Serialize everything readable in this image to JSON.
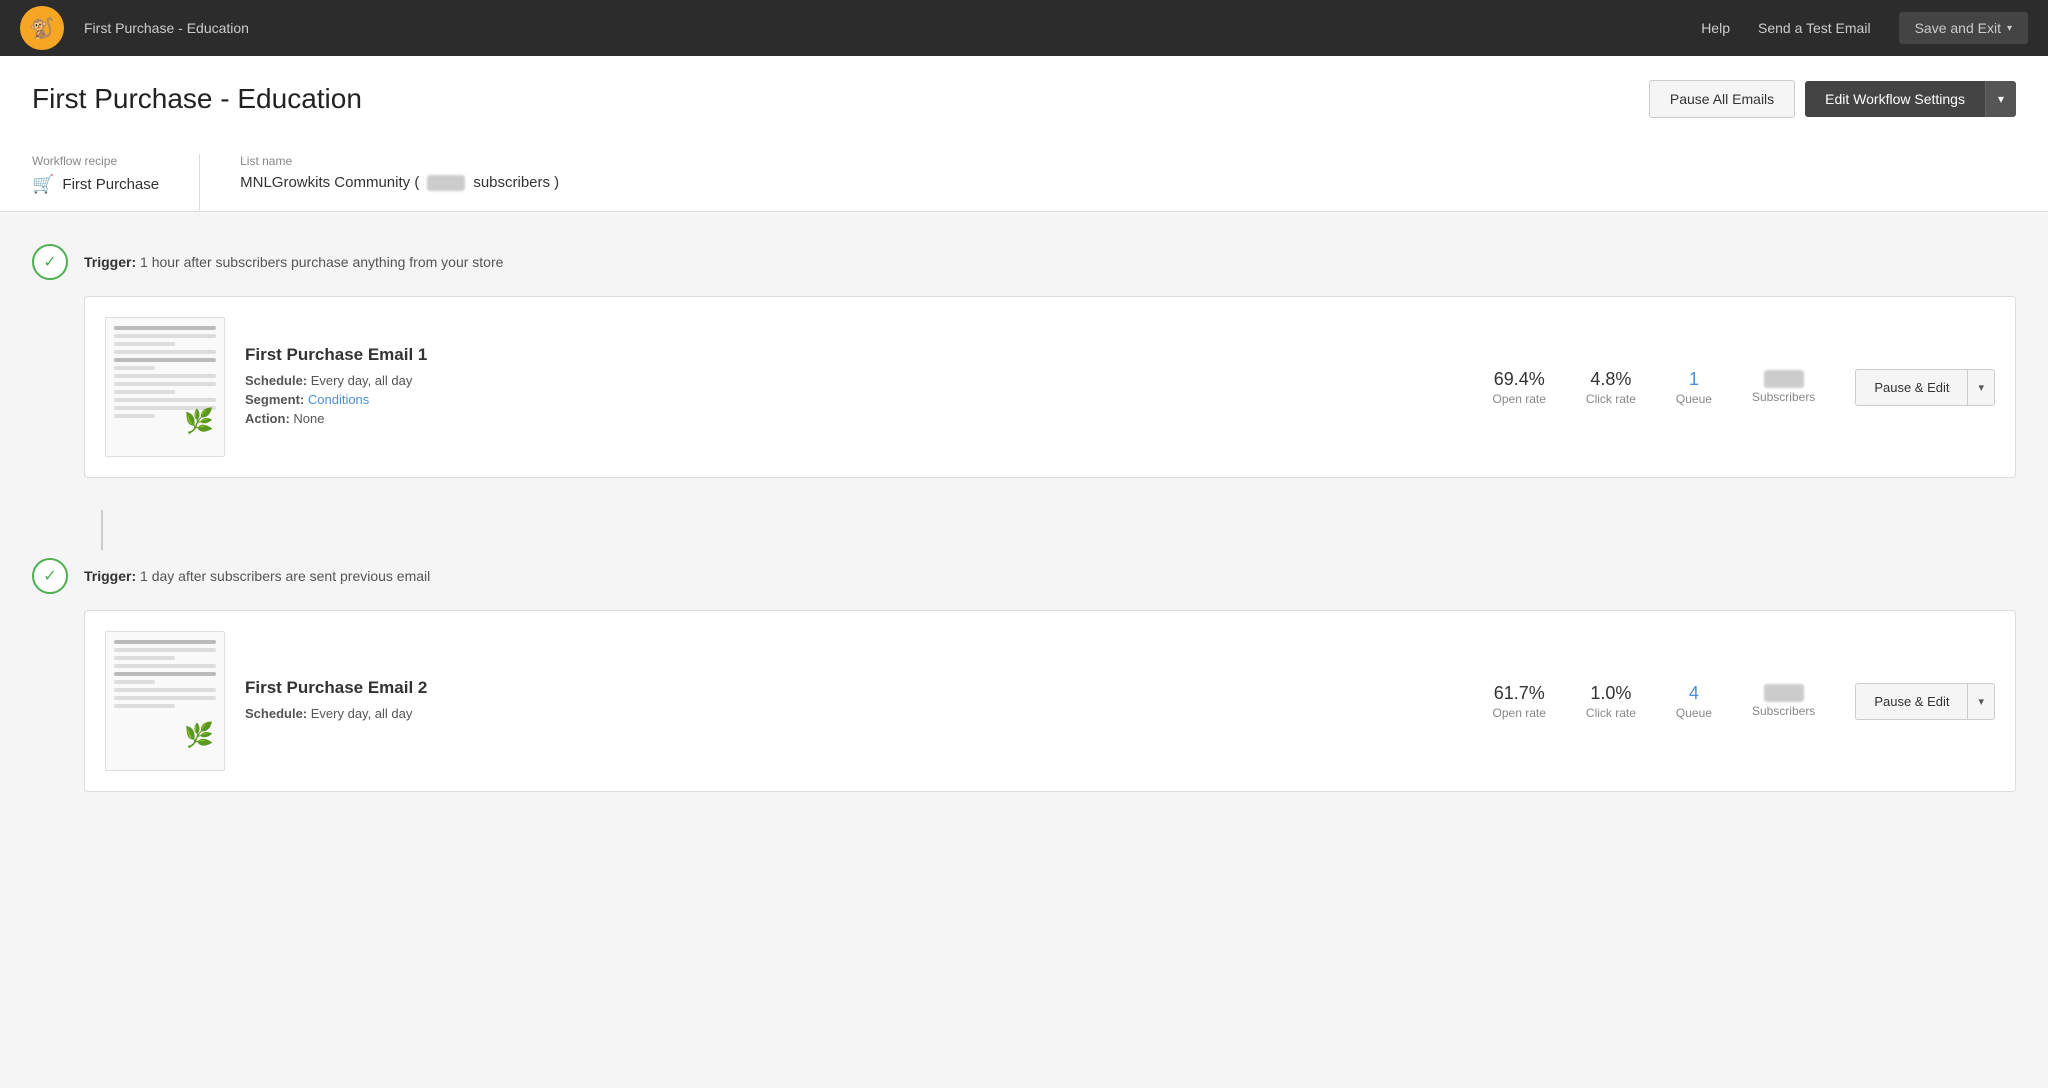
{
  "topNav": {
    "title": "First Purchase - Education",
    "helpLabel": "Help",
    "testEmailLabel": "Send a Test Email",
    "saveExitLabel": "Save and Exit"
  },
  "pageHeader": {
    "title": "First Purchase - Education",
    "pauseAllLabel": "Pause All Emails",
    "editWorkflowLabel": "Edit Workflow Settings"
  },
  "metadata": {
    "recipeLabel": "Workflow recipe",
    "recipeName": "First Purchase",
    "listLabel": "List name",
    "listName": "MNLGrowkits Community (",
    "listNameSuffix": "subscribers )"
  },
  "trigger1": {
    "text": "1 hour after subscribers purchase anything from your store"
  },
  "email1": {
    "name": "First Purchase Email 1",
    "schedule": "Every day, all day",
    "segment": "Conditions",
    "action": "None",
    "openRate": "69.4%",
    "openRateLabel": "Open rate",
    "clickRate": "4.8%",
    "clickRateLabel": "Click rate",
    "queue": "1",
    "queueLabel": "Queue",
    "subscribersLabel": "Subscribers",
    "pauseEditLabel": "Pause & Edit"
  },
  "trigger2": {
    "text": "1 day after subscribers are sent previous email"
  },
  "email2": {
    "name": "First Purchase Email 2",
    "schedule": "Every day, all day",
    "openRate": "61.7%",
    "openRateLabel": "Open rate",
    "clickRate": "1.0%",
    "clickRateLabel": "Click rate",
    "queue": "4",
    "queueLabel": "Queue",
    "subscribersLabel": "Subscribers",
    "pauseEditLabel": "Pause & Edit"
  },
  "labels": {
    "triggerPrefix": "Trigger:",
    "scheduleLabel": "Schedule:",
    "segmentLabel": "Segment:",
    "actionLabel": "Action:"
  }
}
